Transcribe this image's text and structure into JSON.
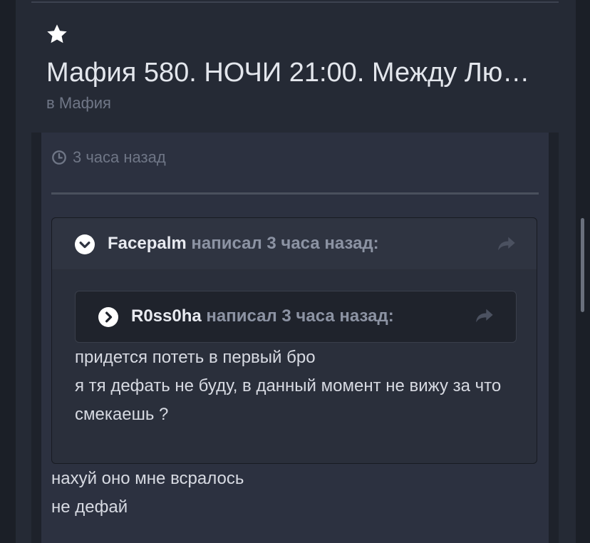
{
  "topic": {
    "title": "Мафия 580. НОЧИ 21:00. Между Лю…",
    "forum_prefix": "в",
    "forum_name": "Мафия"
  },
  "post": {
    "time": "3 часа назад",
    "quote": {
      "author": "Facepalm",
      "meta": "написал 3 часа назад:",
      "nested_quote": {
        "author": "R0ss0ha",
        "meta": "написал 3 часа назад:"
      },
      "lines": [
        "придется потеть в первый бро",
        "я тя дефать не буду, в данный момент не вижу за что",
        "смекаешь ?"
      ]
    },
    "lines": [
      "нахуй оно мне всралось",
      "не дефай"
    ]
  },
  "icons": {
    "favorite": "star-icon",
    "time": "clock-icon",
    "collapse": "chevron-down-icon",
    "expand": "chevron-right-icon",
    "share": "share-icon"
  },
  "colors": {
    "background": "#252a35",
    "title": "#e3e6ec",
    "muted": "#707787",
    "text": "#d7dae2"
  }
}
